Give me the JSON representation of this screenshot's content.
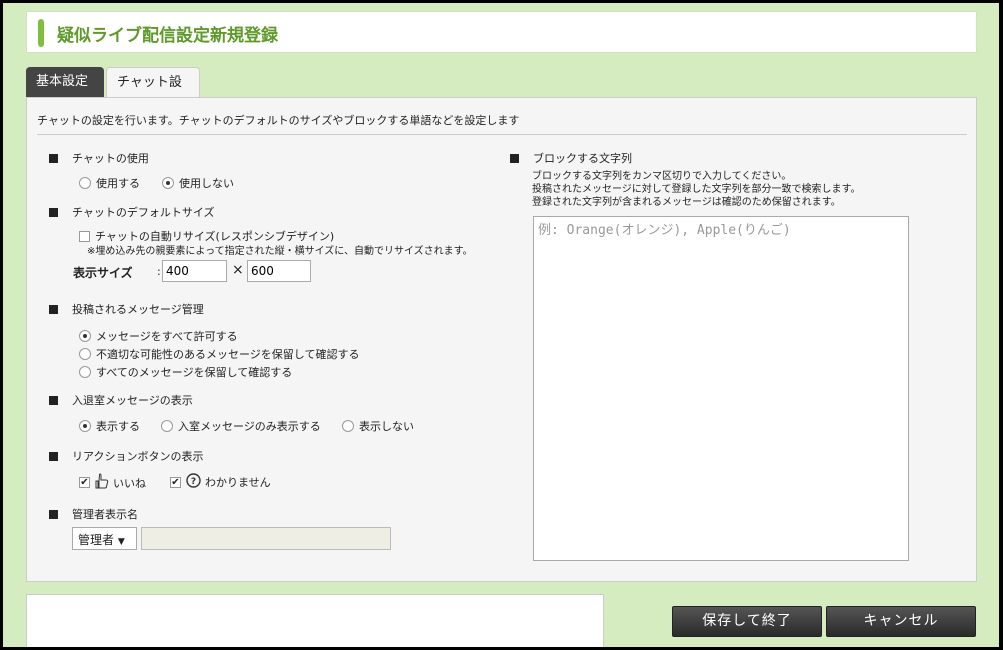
{
  "page": {
    "title": "疑似ライブ配信設定新規登録"
  },
  "tabs": [
    {
      "label": "基本設定",
      "active": false
    },
    {
      "label": "チャット設定",
      "active": true
    }
  ],
  "description": "チャットの設定を行います。チャットのデフォルトのサイズやブロックする単語などを設定します",
  "chat_use": {
    "heading": "チャットの使用",
    "options": [
      {
        "label": "使用する",
        "selected": false
      },
      {
        "label": "使用しない",
        "selected": true
      }
    ]
  },
  "default_size": {
    "heading": "チャットのデフォルトサイズ",
    "auto_resize_label": "チャットの自動リサイズ(レスポンシブデザイン)",
    "auto_resize_checked": false,
    "auto_resize_note": "※埋め込み先の親要素によって指定された縦・横サイズに、自動でリサイズされます。",
    "size_label": "表示サイズ",
    "colon": ":",
    "width": "400",
    "times": "×",
    "height": "600"
  },
  "message_mgmt": {
    "heading": "投稿されるメッセージ管理",
    "options": [
      {
        "label": "メッセージをすべて許可する",
        "selected": true
      },
      {
        "label": "不適切な可能性のあるメッセージを保留して確認する",
        "selected": false
      },
      {
        "label": "すべてのメッセージを保留して確認する",
        "selected": false
      }
    ]
  },
  "entry_msg": {
    "heading": "入退室メッセージの表示",
    "options": [
      {
        "label": "表示する",
        "selected": true
      },
      {
        "label": "入室メッセージのみ表示する",
        "selected": false
      },
      {
        "label": "表示しない",
        "selected": false
      }
    ]
  },
  "reaction": {
    "heading": "リアクションボタンの表示",
    "like_label": "いいね",
    "like_checked": true,
    "unknown_label": "わかりません",
    "unknown_checked": true,
    "check_mark": "✔",
    "like_icon": "hand-thumb-icon",
    "unknown_icon": "question-circle-icon"
  },
  "admin_name": {
    "heading": "管理者表示名",
    "select_value": "管理者",
    "select_arrow": "▼",
    "name_value": ""
  },
  "block_words": {
    "heading": "ブロックする文字列",
    "help": [
      "ブロックする文字列をカンマ区切りで入力してください。",
      "投稿されたメッセージに対して登録した文字列を部分一致で検索します。",
      "登録された文字列が含まれるメッセージは確認のため保留されます。"
    ],
    "placeholder": "例: Orange(オレンジ), Apple(りんご)"
  },
  "buttons": {
    "save": "保存して終了",
    "cancel": "キャンセル"
  },
  "colors": {
    "accent": "#7fbf3d",
    "background": "#d4ecc0",
    "button": "#333333"
  }
}
